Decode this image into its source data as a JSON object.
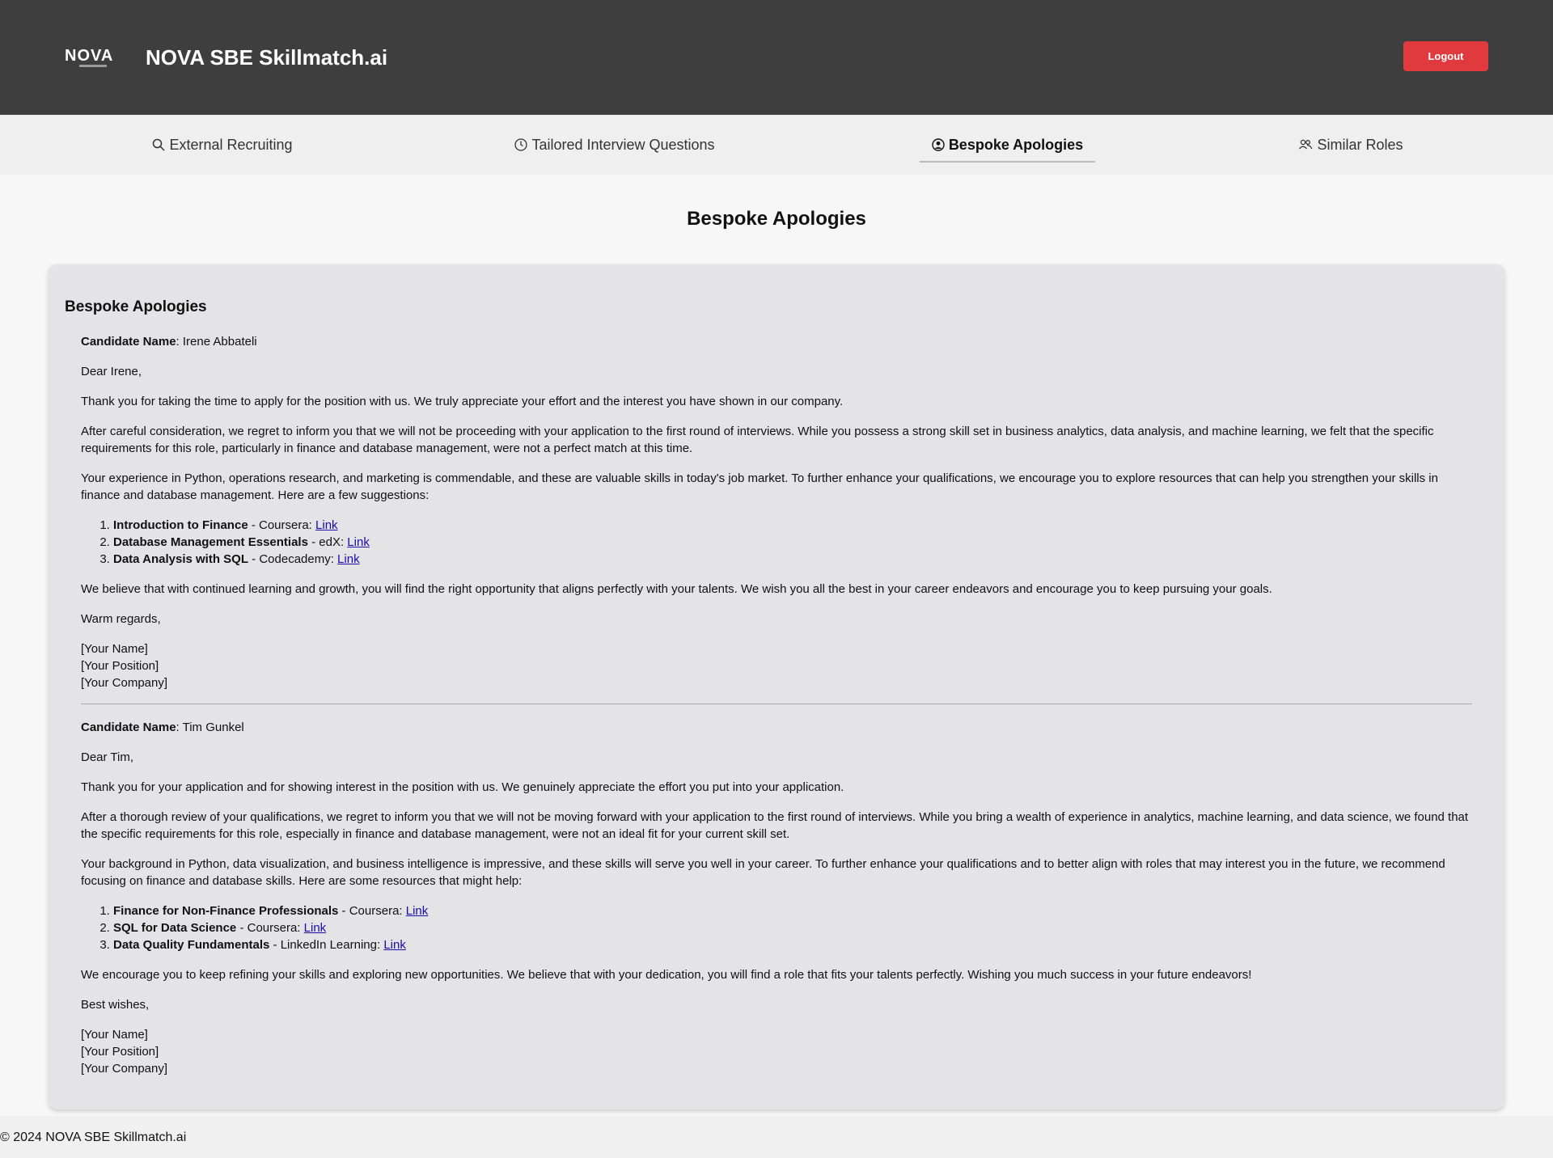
{
  "header": {
    "logo_text": "NOVA",
    "app_title": "NOVA SBE Skillmatch.ai",
    "logout_label": "Logout",
    "logout_color": "#e03a3e"
  },
  "tabs": [
    {
      "label": "External Recruiting",
      "icon": "search-icon",
      "active": false
    },
    {
      "label": "Tailored Interview Questions",
      "icon": "clock-icon",
      "active": false
    },
    {
      "label": "Bespoke Apologies",
      "icon": "user-circle-icon",
      "active": true
    },
    {
      "label": "Similar Roles",
      "icon": "users-icon",
      "active": false
    }
  ],
  "page_heading": "Bespoke Apologies",
  "card_title": "Bespoke Apologies",
  "letters": [
    {
      "candidate_label": "Candidate Name",
      "candidate_name": ": Irene Abbateli",
      "greeting": "Dear Irene,",
      "p1": "Thank you for taking the time to apply for the position with us. We truly appreciate your effort and the interest you have shown in our company.",
      "p2": "After careful consideration, we regret to inform you that we will not be proceeding with your application to the first round of interviews. While you possess a strong skill set in business analytics, data analysis, and machine learning, we felt that the specific requirements for this role, particularly in finance and database management, were not a perfect match at this time.",
      "p3": "Your experience in Python, operations research, and marketing is commendable, and these are valuable skills in today's job market. To further enhance your qualifications, we encourage you to explore resources that can help you strengthen your skills in finance and database management. Here are a few suggestions:",
      "resources": [
        {
          "title": "Introduction to Finance",
          "source": " - Coursera: ",
          "link": "Link"
        },
        {
          "title": "Database Management Essentials",
          "source": " - edX: ",
          "link": "Link"
        },
        {
          "title": "Data Analysis with SQL",
          "source": " - Codecademy: ",
          "link": "Link"
        }
      ],
      "p4": "We believe that with continued learning and growth, you will find the right opportunity that aligns perfectly with your talents. We wish you all the best in your career endeavors and encourage you to keep pursuing your goals.",
      "closing": "Warm regards,",
      "sig_name": "[Your Name]",
      "sig_position": "[Your Position]",
      "sig_company": "[Your Company]"
    },
    {
      "candidate_label": "Candidate Name",
      "candidate_name": ": Tim Gunkel",
      "greeting": "Dear Tim,",
      "p1": "Thank you for your application and for showing interest in the position with us. We genuinely appreciate the effort you put into your application.",
      "p2": "After a thorough review of your qualifications, we regret to inform you that we will not be moving forward with your application to the first round of interviews. While you bring a wealth of experience in analytics, machine learning, and data science, we found that the specific requirements for this role, especially in finance and database management, were not an ideal fit for your current skill set.",
      "p3": "Your background in Python, data visualization, and business intelligence is impressive, and these skills will serve you well in your career. To further enhance your qualifications and to better align with roles that may interest you in the future, we recommend focusing on finance and database skills. Here are some resources that might help:",
      "resources": [
        {
          "title": "Finance for Non-Finance Professionals",
          "source": " - Coursera: ",
          "link": "Link"
        },
        {
          "title": "SQL for Data Science",
          "source": " - Coursera: ",
          "link": "Link"
        },
        {
          "title": "Data Quality Fundamentals",
          "source": " - LinkedIn Learning: ",
          "link": "Link"
        }
      ],
      "p4": "We encourage you to keep refining your skills and exploring new opportunities. We believe that with your dedication, you will find a role that fits your talents perfectly. Wishing you much success in your future endeavors!",
      "closing": "Best wishes,",
      "sig_name": "[Your Name]",
      "sig_position": "[Your Position]",
      "sig_company": "[Your Company]"
    }
  ],
  "footer": {
    "text": "© 2024 NOVA SBE Skillmatch.ai"
  }
}
